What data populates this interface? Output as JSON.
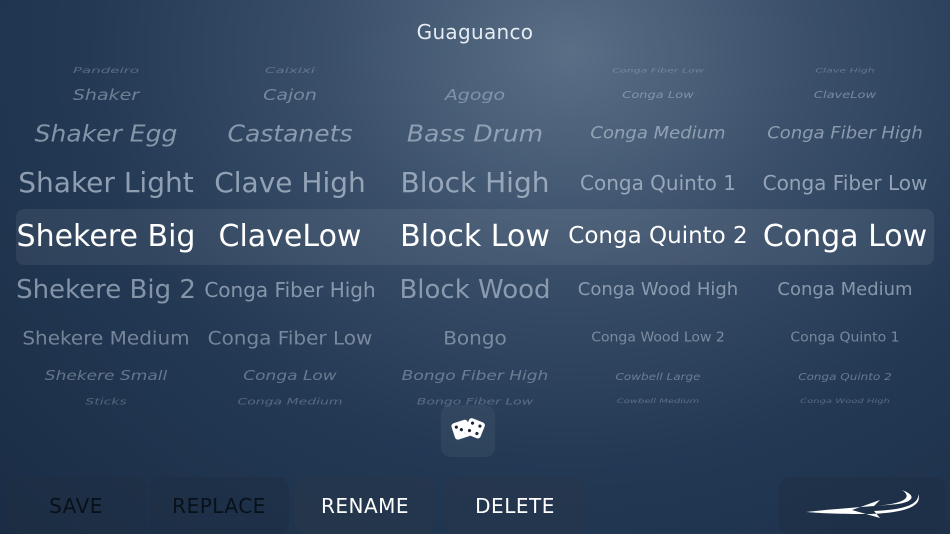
{
  "title": "Guaguanco",
  "wheels": [
    {
      "selected": "Shekere Big",
      "items": [
        "Pandeiro",
        "Shaker",
        "Shaker Egg",
        "Shaker Light",
        "Shekere Big",
        "Shekere Big 2",
        "Shekere Medium",
        "Shekere Small",
        "Sticks"
      ]
    },
    {
      "selected": "ClaveLow",
      "items": [
        "Caixixi",
        "Cajon",
        "Castanets",
        "Clave High",
        "ClaveLow",
        "Conga Fiber High",
        "Conga Fiber Low",
        "Conga Low",
        "Conga Medium"
      ]
    },
    {
      "selected": "Block Low",
      "items": [
        "",
        "Agogo",
        "Bass Drum",
        "Block High",
        "Block Low",
        "Block Wood",
        "Bongo",
        "Bongo Fiber High",
        "Bongo Fiber Low"
      ]
    },
    {
      "selected": "Conga Quinto 2",
      "items": [
        "Conga Fiber Low",
        "Conga Low",
        "Conga Medium",
        "Conga Quinto 1",
        "Conga Quinto 2",
        "Conga Wood High",
        "Conga Wood Low 2",
        "Cowbell Large",
        "Cowbell Medium"
      ]
    },
    {
      "selected": "Conga Low",
      "items": [
        "Clave High",
        "ClaveLow",
        "Conga Fiber High",
        "Conga Fiber Low",
        "Conga Low",
        "Conga Medium",
        "Conga Quinto 1",
        "Conga Quinto 2",
        "Conga Wood High"
      ]
    }
  ],
  "randomize_icon": "dice-icon",
  "buttons": {
    "save": "SAVE",
    "replace": "REPLACE",
    "rename": "RENAME",
    "delete": "DELETE"
  },
  "back_icon": "swoosh-arrow-icon"
}
